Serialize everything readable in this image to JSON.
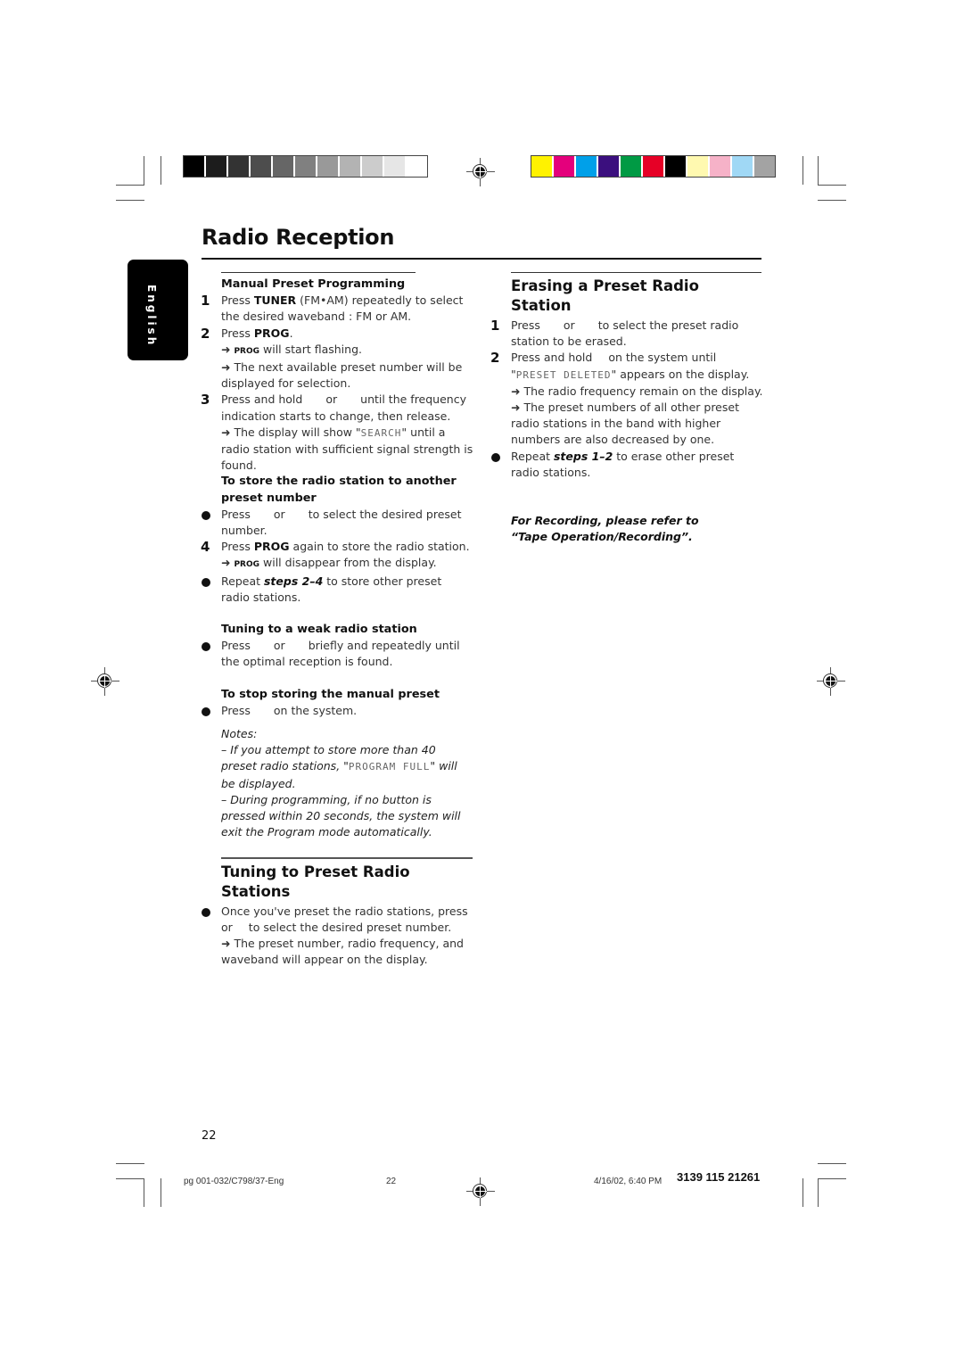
{
  "print_marks": {
    "gray_swatches": [
      "#000000",
      "#1c1c1c",
      "#333333",
      "#4d4d4d",
      "#666666",
      "#808080",
      "#999999",
      "#b3b3b3",
      "#cccccc",
      "#e6e6e6",
      "#ffffff"
    ],
    "color_swatches": [
      "#fff200",
      "#e4007c",
      "#00a0e9",
      "#3b0f7e",
      "#009a44",
      "#e60026",
      "#000000",
      "#fff9b0",
      "#f6b2c8",
      "#a0d8f5",
      "#a3a3a3"
    ]
  },
  "page": {
    "title": "Radio Reception",
    "language_tab": "English",
    "page_number": "22"
  },
  "left": {
    "manual_heading": "Manual Preset Programming",
    "step1_num": "1",
    "step1_a": "Press ",
    "step1_b": "TUNER",
    "step1_c": " (FM•AM) repeatedly to select the desired waveband : FM or AM.",
    "step2_num": "2",
    "step2_a": "Press ",
    "step2_b": "PROG",
    "step2_c": ".",
    "step2_r1_a": "➜ ",
    "step2_r1_b": "PROG",
    "step2_r1_c": " will start flashing.",
    "step2_r2": "➜ The next available preset number will be displayed for selection.",
    "step3_num": "3",
    "step3_a": "Press and hold",
    "step3_b": "or",
    "step3_c": "until the frequency indication starts to change, then release.",
    "step3_r1_a": "➜ The display will show \"",
    "step3_r1_lcd": "SEARCH",
    "step3_r1_b": "\" until a radio station with sufficient signal strength is found.",
    "store_heading": "To store the radio station to another preset number",
    "store_b_a": "Press",
    "store_b_b": "or",
    "store_b_c": "to select the desired preset number.",
    "step4_num": "4",
    "step4_a": "Press ",
    "step4_b": "PROG",
    "step4_c": " again to store the radio station.",
    "step4_r_a": "➜ ",
    "step4_r_b": "PROG",
    "step4_r_c": " will disappear from the display.",
    "repeat_a": "Repeat ",
    "repeat_b": "steps 2–4",
    "repeat_c": " to store other preset radio stations.",
    "weak_heading": "Tuning to a weak radio station",
    "weak_a": "Press",
    "weak_b": "or",
    "weak_c": "briefly and repeatedly until the optimal reception is found.",
    "stop_heading": "To stop storing the manual preset",
    "stop_a": "Press",
    "stop_b": "on the system.",
    "notes_label": "Notes:",
    "note1_a": "–  If you attempt to store more than 40 preset radio stations, \"",
    "note1_lcd": "PROGRAM FULL",
    "note1_b": "\" will be displayed.",
    "note2": "–  During programming, if no button is pressed within 20 seconds, the system will exit the Program mode automatically.",
    "tuning_heading": "Tuning to Preset Radio Stations",
    "tuning_a": "Once you've preset the radio stations, press",
    "tuning_b": "or",
    "tuning_c": "to select the desired preset number.",
    "tuning_r": "➜ The preset number, radio frequency, and waveband will appear on the display."
  },
  "right": {
    "erase_heading": "Erasing a Preset Radio Station",
    "e1_num": "1",
    "e1_a": "Press",
    "e1_b": "or",
    "e1_c": "to select the preset radio station to be erased.",
    "e2_num": "2",
    "e2_a": "Press and hold",
    "e2_b": "on the system until \"",
    "e2_lcd": "PRESET DELETED",
    "e2_c": "\" appears on the display.",
    "e2_r1": "➜ The radio frequency remain on the display.",
    "e2_r2": "➜ The preset numbers of all other preset radio stations in the band with higher numbers are also decreased by one.",
    "repeat_a": "Repeat ",
    "repeat_b": "steps 1–2",
    "repeat_c": " to erase other preset radio stations.",
    "recording_note": "For Recording, please refer to “Tape Operation/Recording”."
  },
  "footer": {
    "file": "pg 001-032/C798/37-Eng",
    "page": "22",
    "datetime": "4/16/02, 6:40 PM",
    "code": "3139 115 21261"
  }
}
